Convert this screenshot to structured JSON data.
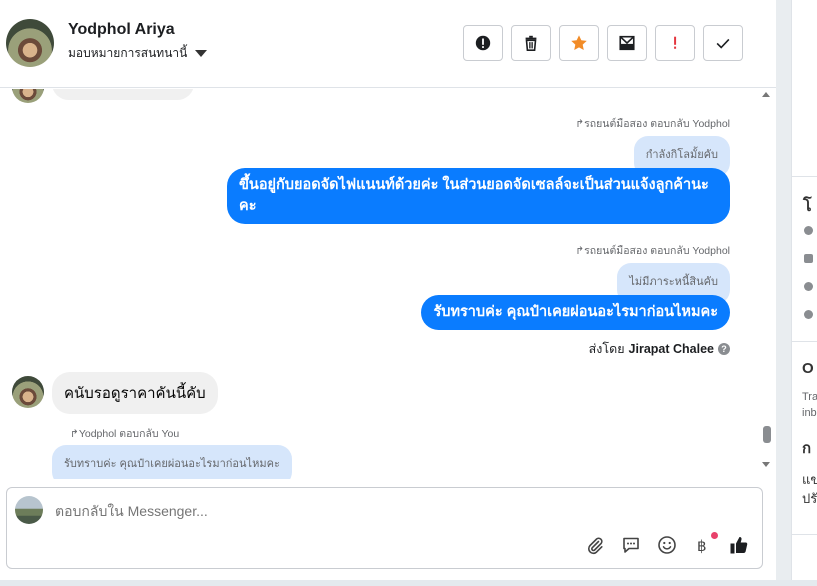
{
  "header": {
    "contact_name": "Yodphol Ariya",
    "assign_label": "มอบหมายการสนทนานี้",
    "actions": [
      {
        "name": "alert-icon"
      },
      {
        "name": "trash-icon"
      },
      {
        "name": "star-icon",
        "color": "#f28c28"
      },
      {
        "name": "mail-archive-icon"
      },
      {
        "name": "exclamation-icon",
        "color": "#e4343e"
      },
      {
        "name": "check-icon"
      }
    ]
  },
  "thread": {
    "messages": [
      {
        "reply_tag": "รถยนต์มือสอง ตอบกลับ Yodphol",
        "quote": "กำลังกิโลมั้ยคับ",
        "text": "ขึ้นอยู่กับยอดจัดไฟแนนท์ด้วยค่ะ ในส่วนยอดจัดเซลล์จะเป็นส่วนแจ้งลูกค้านะคะ"
      },
      {
        "reply_tag": "รถยนต์มือสอง ตอบกลับ Yodphol",
        "quote": "ไม่มีภาระหนี้สินคับ",
        "text": "รับทราบค่ะ คุณป๋าเคยผ่อนอะไรมาก่อนไหมคะ"
      }
    ],
    "sent_by_label": "ส่งโดย",
    "sent_by_name": "Jirapat Chalee",
    "incoming": {
      "text": "คนับรอดูราคาคันนี้คับ"
    },
    "incoming_reply": {
      "reply_tag": "Yodphol ตอบกลับ You",
      "quote": "รับทราบค่ะ คุณป๋าเคยผ่อนอะไรมาก่อนไหมคะ"
    }
  },
  "composer": {
    "placeholder": "ตอบกลับใน Messenger...",
    "tools": [
      "paperclip-icon",
      "chat-bubble-icon",
      "emoji-icon",
      "baht-icon",
      "thumbs-up-icon"
    ]
  },
  "right_panel": {
    "texts": [
      "โ",
      "O",
      "Tra",
      "inb",
      "ก",
      "แข",
      "ปรั"
    ]
  },
  "colors": {
    "outgoing_bubble": "#0a7cff",
    "quote_bubble": "#d6e6fb",
    "incoming_bubble": "#f0f0f0"
  }
}
